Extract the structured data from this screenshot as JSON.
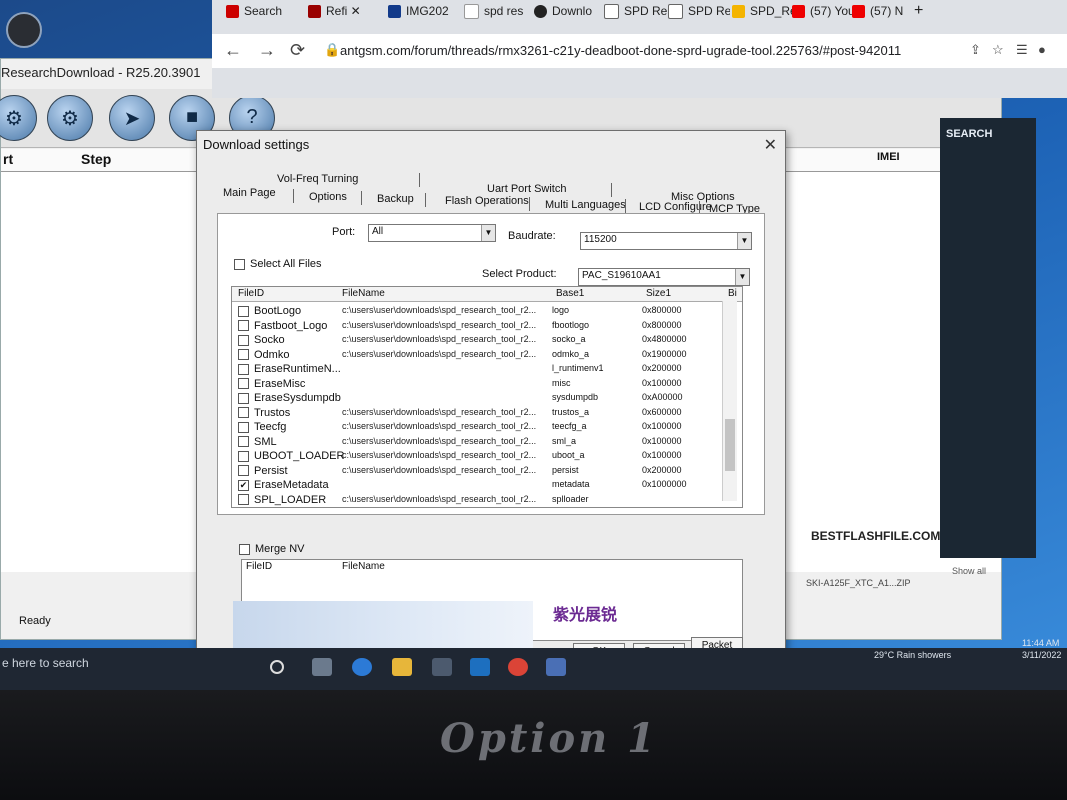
{
  "browser": {
    "tabs": [
      "Search",
      "Refi",
      "IMG202",
      "spd res",
      "Downlo",
      "SPD Re",
      "SPD Re",
      "SPD_Re",
      "(57) You",
      "(57) N"
    ],
    "url": "antgsm.com/forum/threads/rmx3261-c21y-deadboot-done-sprd-ugrade-tool.225763/#post-942011"
  },
  "app": {
    "title": "ResearchDownload - R25.20.3901",
    "col_port": "rt",
    "col_step": "Step",
    "col_imei": "IMEI",
    "status": "Ready",
    "watermark": "BESTFLASHFILE.COM",
    "right_search": "SEARCH"
  },
  "dialog": {
    "title": "Download settings",
    "tabs_row1": [
      "Vol-Freq Turning",
      "Uart Port Switch",
      "Misc Options"
    ],
    "tabs_row2": [
      "Main Page",
      "Options",
      "Backup",
      "Flash Operations",
      "Multi Languages",
      "LCD Configure",
      "MCP Type"
    ],
    "port_label": "Port:",
    "port_value": "All",
    "baud_label": "Baudrate:",
    "baud_value": "115200",
    "select_all": "Select All Files",
    "product_label": "Select Product:",
    "product_value": "PAC_S19610AA1",
    "columns": [
      "FileID",
      "FileName",
      "Base1",
      "Size1",
      "Bi"
    ],
    "rows": [
      {
        "id": "BootLogo",
        "fn": "c:\\users\\user\\downloads\\spd_research_tool_r2...",
        "base": "logo",
        "size": "0x800000",
        "checked": false
      },
      {
        "id": "Fastboot_Logo",
        "fn": "c:\\users\\user\\downloads\\spd_research_tool_r2...",
        "base": "fbootlogo",
        "size": "0x800000",
        "checked": false
      },
      {
        "id": "Socko",
        "fn": "c:\\users\\user\\downloads\\spd_research_tool_r2...",
        "base": "socko_a",
        "size": "0x4800000",
        "checked": false
      },
      {
        "id": "Odmko",
        "fn": "c:\\users\\user\\downloads\\spd_research_tool_r2...",
        "base": "odmko_a",
        "size": "0x1900000",
        "checked": false
      },
      {
        "id": "EraseRuntimeN...",
        "fn": "",
        "base": "l_runtimenv1",
        "size": "0x200000",
        "checked": false
      },
      {
        "id": "EraseMisc",
        "fn": "",
        "base": "misc",
        "size": "0x100000",
        "checked": false
      },
      {
        "id": "EraseSysdumpdb",
        "fn": "",
        "base": "sysdumpdb",
        "size": "0xA00000",
        "checked": false
      },
      {
        "id": "Trustos",
        "fn": "c:\\users\\user\\downloads\\spd_research_tool_r2...",
        "base": "trustos_a",
        "size": "0x600000",
        "checked": false
      },
      {
        "id": "Teecfg",
        "fn": "c:\\users\\user\\downloads\\spd_research_tool_r2...",
        "base": "teecfg_a",
        "size": "0x100000",
        "checked": false
      },
      {
        "id": "SML",
        "fn": "c:\\users\\user\\downloads\\spd_research_tool_r2...",
        "base": "sml_a",
        "size": "0x100000",
        "checked": false
      },
      {
        "id": "UBOOT_LOADER",
        "fn": "c:\\users\\user\\downloads\\spd_research_tool_r2...",
        "base": "uboot_a",
        "size": "0x100000",
        "checked": false
      },
      {
        "id": "Persist",
        "fn": "c:\\users\\user\\downloads\\spd_research_tool_r2...",
        "base": "persist",
        "size": "0x200000",
        "checked": false
      },
      {
        "id": "EraseMetadata",
        "fn": "",
        "base": "metadata",
        "size": "0x1000000",
        "checked": true
      },
      {
        "id": "SPL_LOADER",
        "fn": "c:\\users\\user\\downloads\\spd_research_tool_r2...",
        "base": "splloader",
        "size": "",
        "checked": false
      }
    ],
    "merge_nv": "Merge NV",
    "merge_cols": [
      "FileID",
      "FileName"
    ],
    "logo_text": "紫光展锐",
    "buttons": {
      "ok": "OK",
      "cancel": "Cancel",
      "packet": "Packet"
    }
  },
  "taskbar": {
    "search_text": "e here to search",
    "weather": "29°C  Rain showers",
    "time": "11:44 AM",
    "date": "3/11/2022",
    "download_item": "SKI-A125F_XTC_A1...ZIP",
    "show_all": "Show all"
  },
  "monitor_brand": "Option 1"
}
